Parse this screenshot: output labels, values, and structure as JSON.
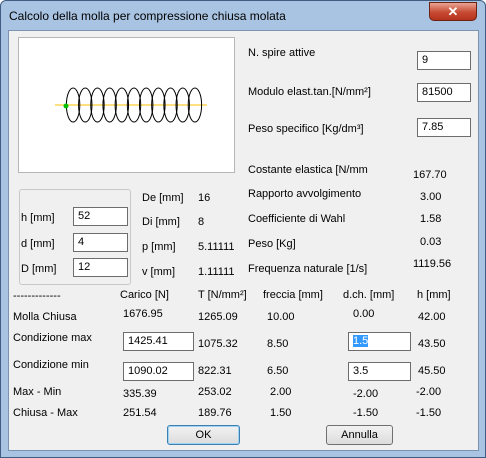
{
  "window": {
    "title": "Calcolo della molla per compressione chiusa molata",
    "close_glyph": "✕"
  },
  "inputs": {
    "spire_label": "N. spire attive",
    "spire_value": "9",
    "modulo_label": "Modulo elast.tan.[N/mm²]",
    "modulo_value": "81500",
    "peso_label": "Peso specifico [Kg/dm³]",
    "peso_value": "7.85"
  },
  "results": {
    "costante_label": "Costante elastica [N/mm",
    "costante_value": "167.70",
    "rapporto_label": "Rapporto avvolgimento",
    "rapporto_value": "3.00",
    "wahl_label": "Coefficiente di Wahl",
    "wahl_value": "1.58",
    "pesokg_label": "Peso [Kg]",
    "pesokg_value": "0.03",
    "freq_label": "Frequenza naturale [1/s]",
    "freq_value": "1119.56"
  },
  "dims": {
    "h_label": "h [mm]",
    "h_value": "52",
    "d_label": "d [mm]",
    "d_value": "4",
    "D_label": "D [mm]",
    "D_value": "12",
    "De_label": "De [mm]",
    "De_value": "16",
    "Di_label": "Di [mm]",
    "Di_value": "8",
    "p_label": "p [mm]",
    "p_value": "5.11111",
    "v_label": "v [mm]",
    "v_value": "1.11111"
  },
  "table": {
    "dash": "-------------",
    "headers": [
      "Carico [N]",
      "T [N/mm²]",
      "freccia [mm]",
      "d.ch. [mm]",
      "h [mm]"
    ],
    "molla_chiusa": {
      "label": "Molla   Chiusa",
      "carico": "1676.95",
      "t": "1265.09",
      "freccia": "10.00",
      "dch": "0.00",
      "h": "42.00"
    },
    "cond_max": {
      "label": "Condizione max",
      "carico": "1425.41",
      "t": "1075.32",
      "freccia": "8.50",
      "dch": "1.5",
      "h": "43.50"
    },
    "cond_min": {
      "label": "Condizione min",
      "carico": "1090.02",
      "t": "822.31",
      "freccia": "6.50",
      "dch": "3.5",
      "h": "45.50"
    },
    "max_min": {
      "label": "Max   -   Min",
      "carico": "335.39",
      "t": "253.02",
      "freccia": "2.00",
      "dch": "-2.00",
      "h": "-2.00"
    },
    "chiusa_max": {
      "label": "Chiusa  -  Max",
      "carico": "251.54",
      "t": "189.76",
      "freccia": "1.50",
      "dch": "-1.50",
      "h": "-1.50"
    }
  },
  "buttons": {
    "ok": "OK",
    "annulla": "Annulla"
  },
  "colors": {
    "spring": "#000000",
    "axis": "#ffc000",
    "marker": "#00c000"
  }
}
